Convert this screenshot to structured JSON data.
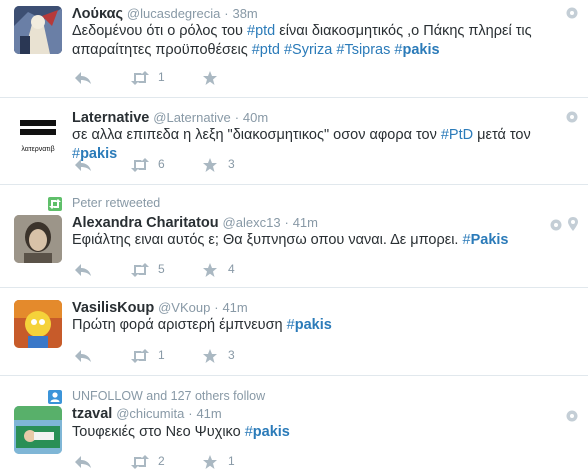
{
  "colors": {
    "link": "#2b7bb9",
    "muted": "#8899a6",
    "icon": "#aab8c2",
    "retweet_green": "#5fbf6a",
    "follow_blue": "#3b94d9"
  },
  "tweets": [
    {
      "name": "Λούκας",
      "handle": "@lucasdegrecia",
      "sep": "·",
      "time": "38m",
      "text_parts": [
        "Δεδομένου ότι ο ρόλος του ",
        "#ptd",
        " είναι διακοσμητικός ,ο Πάκης πληρεί τις απαραίτητες προϋποθέσεις ",
        "#ptd",
        " ",
        "#Syriza",
        " ",
        "#Tsipras",
        " ",
        "#",
        "pakis"
      ],
      "retweets": "1",
      "favorites": ""
    },
    {
      "name": "Laternative",
      "handle": "@Laternative",
      "sep": "·",
      "time": "40m",
      "avatar_text": "λατερνατιβ",
      "text_parts": [
        "σε αλλα επιπεδα η λεξη \"διακοσμητικος\" οσον αφορα τον ",
        "#PtD",
        " μετά τον ",
        "#",
        "pakis"
      ],
      "retweets": "6",
      "favorites": "3"
    },
    {
      "context": "Peter retweeted",
      "name": "Alexandra Charitatou",
      "handle": "@alexc13",
      "sep": "·",
      "time": "41m",
      "text_parts": [
        "Εφιάλτης ειναι αυτός ε; Θα ξυπνησω οπου ναναι. Δε μπορει. ",
        "#",
        "Pakis"
      ],
      "retweets": "5",
      "favorites": "4"
    },
    {
      "name": "VasilisKoup",
      "handle": "@VKoup",
      "sep": "·",
      "time": "41m",
      "text_parts": [
        "Πρώτη φορά αριστερή έμπνευση ",
        "#",
        "pakis"
      ],
      "retweets": "1",
      "favorites": "3"
    },
    {
      "context": "UNFOLLOW and 127 others follow",
      "name": "tzaval",
      "handle": "@chicumita",
      "sep": "·",
      "time": "41m",
      "text_parts": [
        "Τουφεκιές στο Νεο Ψυχικο ",
        "#",
        "pakis"
      ],
      "retweets": "2",
      "favorites": "1"
    }
  ]
}
